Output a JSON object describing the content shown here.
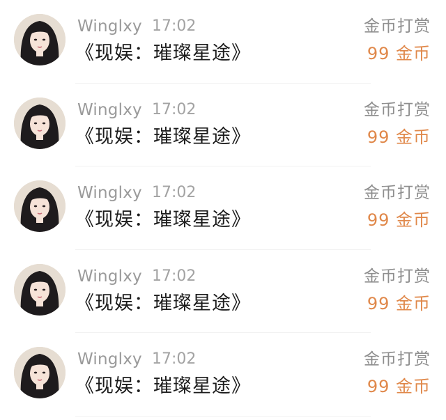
{
  "messages": [
    {
      "username": "Winglxy",
      "time": "17:02",
      "title": "《现娱：璀璨星途》",
      "gift_label": "金币打赏",
      "gift_amount": "99 金币",
      "avatar_icon": "user-avatar"
    },
    {
      "username": "Winglxy",
      "time": "17:02",
      "title": "《现娱：璀璨星途》",
      "gift_label": "金币打赏",
      "gift_amount": "99 金币",
      "avatar_icon": "user-avatar"
    },
    {
      "username": "Winglxy",
      "time": "17:02",
      "title": "《现娱：璀璨星途》",
      "gift_label": "金币打赏",
      "gift_amount": "99 金币",
      "avatar_icon": "user-avatar"
    },
    {
      "username": "Winglxy",
      "time": "17:02",
      "title": "《现娱：璀璨星途》",
      "gift_label": "金币打赏",
      "gift_amount": "99 金币",
      "avatar_icon": "user-avatar"
    },
    {
      "username": "Winglxy",
      "time": "17:02",
      "title": "《现娱：璀璨星途》",
      "gift_label": "金币打赏",
      "gift_amount": "99 金币",
      "avatar_icon": "user-avatar"
    }
  ],
  "colors": {
    "username": "#9a9a9a",
    "time": "#a3a3a3",
    "title": "#1c1c1c",
    "gift_label": "#8e8e8e",
    "gift_amount": "#e0884a"
  }
}
